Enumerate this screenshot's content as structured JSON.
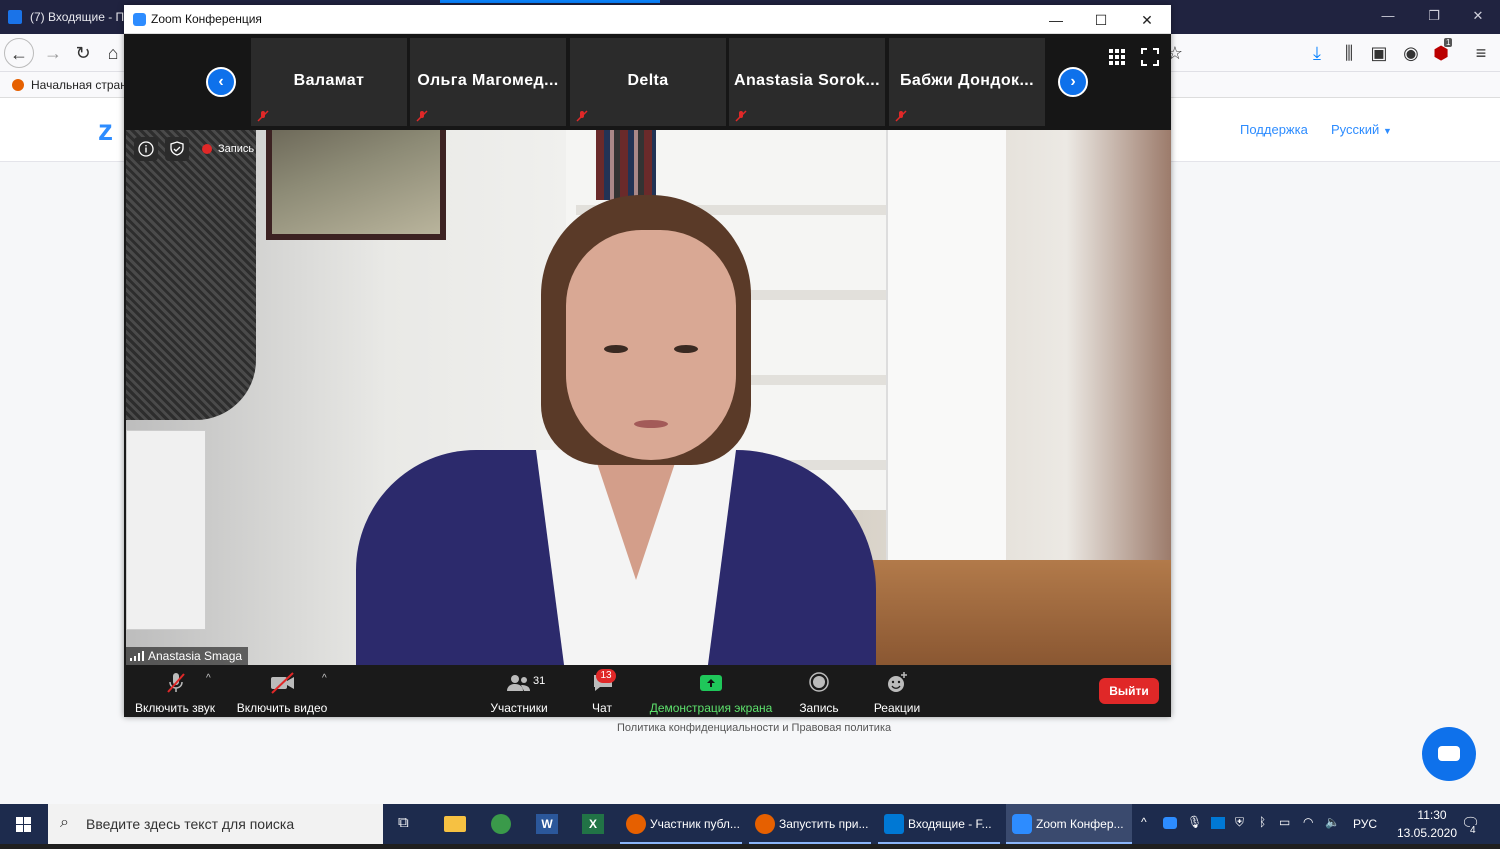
{
  "browser": {
    "tab_title": "(7) Входящие - П",
    "bookmark_label": "Начальная стран",
    "window_controls": [
      "—",
      "❐",
      "✕"
    ],
    "toolbar_badge": "1"
  },
  "site": {
    "support_link": "Поддержка",
    "language_link": "Русский",
    "policy_text": "Политика конфиденциальности и Правовая политика"
  },
  "zoom": {
    "window_title": "Zoom Конференция",
    "participants_strip": [
      "Валамат",
      "Ольга Магомед...",
      "Delta",
      "Anastasia Sorok...",
      "Бабжи Дондок..."
    ],
    "recording_label": "Запись",
    "speaker_name": "Anastasia Smaga",
    "toolbar": {
      "mute_label": "Включить звук",
      "video_label": "Включить видео",
      "participants_label": "Участники",
      "participants_count": "31",
      "chat_label": "Чат",
      "chat_badge": "13",
      "share_label": "Демонстрация экрана",
      "record_label": "Запись",
      "reactions_label": "Реакции",
      "leave_label": "Выйти"
    }
  },
  "taskbar": {
    "search_placeholder": "Введите здесь текст для поиска",
    "tasks": [
      "Участник публ...",
      "Запустить при...",
      "Входящие - F...",
      "Zoom Конфер..."
    ],
    "language": "РУС",
    "time": "11:30",
    "date": "13.05.2020",
    "notifications_count": "4"
  },
  "colors": {
    "accent": "#0e71eb",
    "leave": "#e02828",
    "share_green": "#5de16c",
    "taskbar": "#1d2b4d"
  }
}
